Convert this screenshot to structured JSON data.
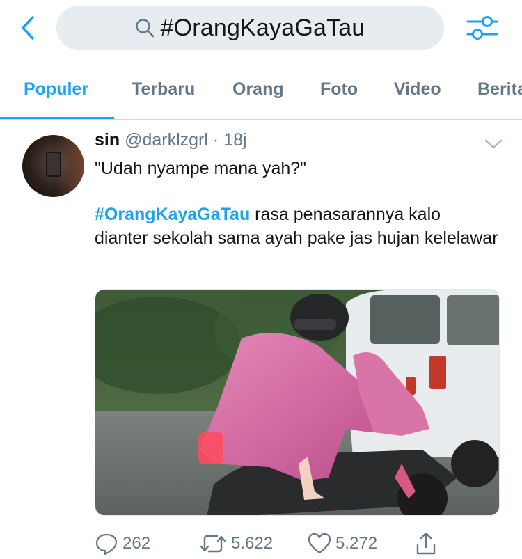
{
  "search": {
    "query": "#OrangKayaGaTau"
  },
  "tabs": [
    {
      "label": "Populer"
    },
    {
      "label": "Terbaru"
    },
    {
      "label": "Orang"
    },
    {
      "label": "Foto"
    },
    {
      "label": "Video"
    },
    {
      "label": "Berita"
    }
  ],
  "tweet": {
    "author_name": "sin",
    "author_handle": "@darklzgrl",
    "separator": "·",
    "time": "18j",
    "line1": "\"Udah nyampe mana yah?\"",
    "hashtag": "#OrangKayaGaTau",
    "line2_rest": " rasa penasarannya kalo dianter sekolah sama ayah pake jas hujan kelelawar",
    "replies": "262",
    "retweets": "5.622",
    "likes": "5.272"
  },
  "colors": {
    "accent": "#1da1f2",
    "text": "#14171a",
    "secondary": "#657786",
    "search_bg": "#e6ecf0",
    "divider": "#ccd6dd"
  },
  "icons": {
    "back": "chevron-left-icon",
    "search": "search-icon",
    "filter": "filter-sliders-icon",
    "caret": "chevron-down-icon",
    "reply": "reply-icon",
    "retweet": "retweet-icon",
    "like": "heart-icon",
    "share": "share-icon"
  }
}
